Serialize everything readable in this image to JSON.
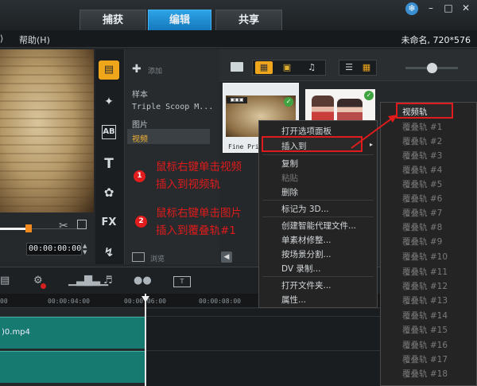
{
  "window": {
    "tabs": [
      "捕获",
      "编辑",
      "共享"
    ],
    "active_tab": "编辑",
    "project_info": "未命名, 720*576",
    "controls": {
      "minimize": "–",
      "maximize": "□",
      "close": "✕",
      "gear": "❄"
    }
  },
  "menubar": {
    "partial_prev": "⟩",
    "help": "帮助(H)"
  },
  "preview": {
    "timecode": "00:00:00:00"
  },
  "library": {
    "add_label": "添加",
    "browse_label": "浏览",
    "items": [
      "样本",
      "Triple Scoop M...",
      "图片",
      "视频"
    ],
    "selected": "视频"
  },
  "media": {
    "thumb1_label": "Fine Pri",
    "thumb1_badge": "▣▣▣"
  },
  "annotations": {
    "step1_num": "1",
    "step1_line1": "鼠标右键单击视频",
    "step1_line2": "插入到视频轨",
    "step2_num": "2",
    "step2_line1": "鼠标右键单击图片",
    "step2_line2": "插入到覆叠轨#1"
  },
  "context_menu": {
    "items": [
      {
        "label": "打开选项面板",
        "enabled": true
      },
      {
        "label": "插入到",
        "enabled": true
      },
      {
        "label": "复制",
        "enabled": true
      },
      {
        "label": "粘贴",
        "enabled": false
      },
      {
        "label": "删除",
        "enabled": true
      },
      {
        "label": "标记为 3D...",
        "enabled": true
      },
      {
        "label": "创建智能代理文件...",
        "enabled": true
      },
      {
        "label": "单素材修整...",
        "enabled": true
      },
      {
        "label": "按场景分割...",
        "enabled": true
      },
      {
        "label": "DV 录制...",
        "enabled": true
      },
      {
        "label": "打开文件夹...",
        "enabled": true
      },
      {
        "label": "属性...",
        "enabled": true
      }
    ],
    "submenu_arrow": "▸"
  },
  "submenu": {
    "items": [
      "视频轨",
      "覆叠轨 #1",
      "覆叠轨 #2",
      "覆叠轨 #3",
      "覆叠轨 #4",
      "覆叠轨 #5",
      "覆叠轨 #6",
      "覆叠轨 #7",
      "覆叠轨 #8",
      "覆叠轨 #9",
      "覆叠轨 #10",
      "覆叠轨 #11",
      "覆叠轨 #12",
      "覆叠轨 #13",
      "覆叠轨 #14",
      "覆叠轨 #15",
      "覆叠轨 #16",
      "覆叠轨 #17",
      "覆叠轨 #18"
    ]
  },
  "timeline": {
    "ruler_ticks": [
      "00",
      "00:00:04:00",
      "00:00:06:00",
      "00:00:08:00"
    ],
    "track1_clip": ")0.mp4"
  },
  "colors": {
    "accent": "#1479be",
    "highlight": "#f0a61b",
    "annotation": "#e01b1b",
    "clip": "#167a70"
  }
}
